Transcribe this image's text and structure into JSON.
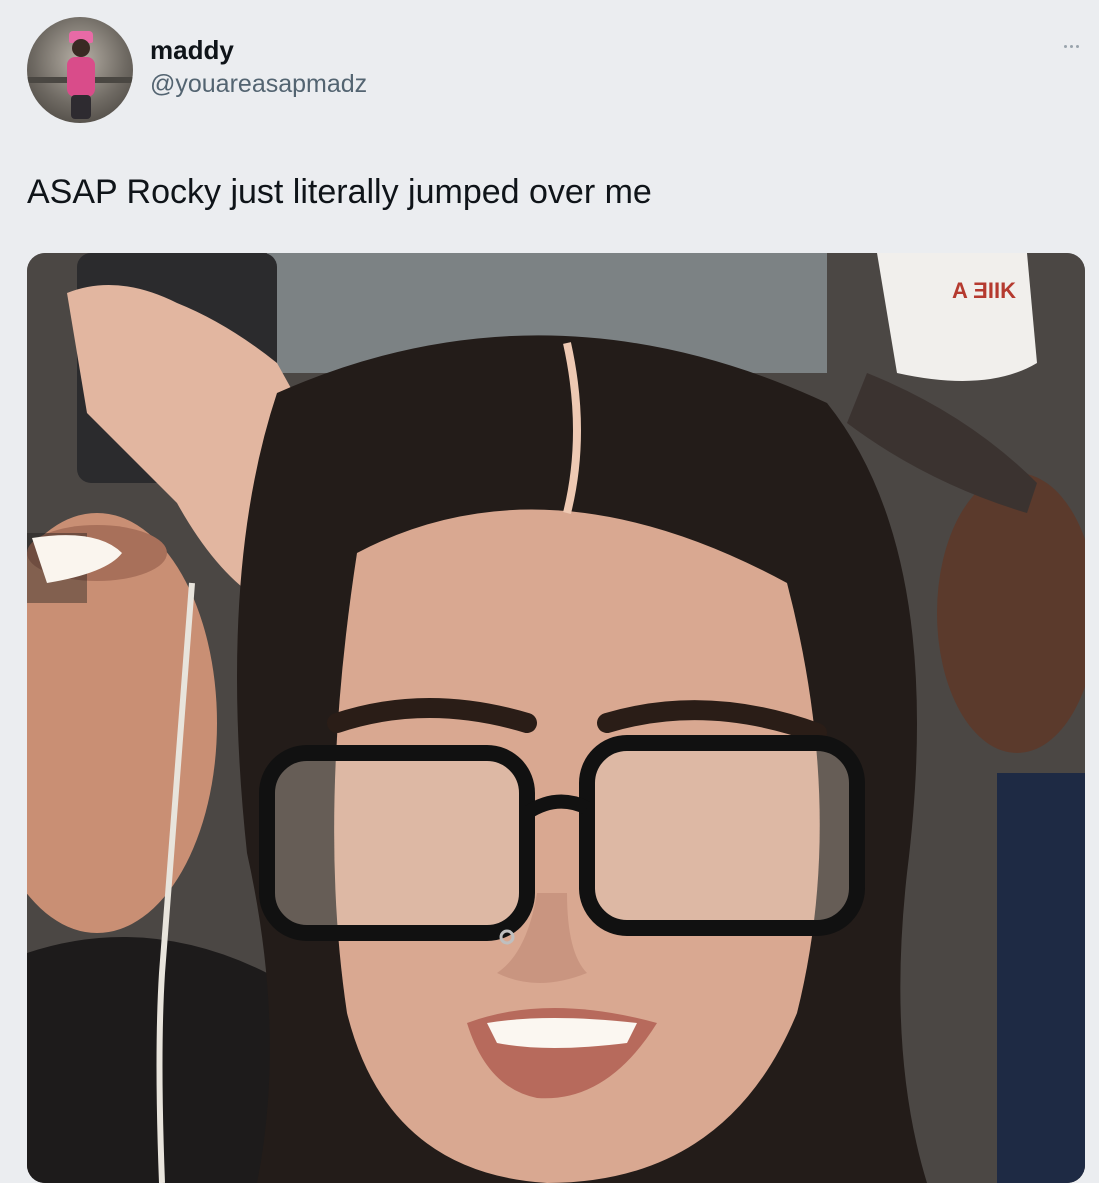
{
  "author": {
    "display_name": "maddy",
    "handle": "@youareasapmadz",
    "avatar_icon": "profile-photo"
  },
  "tweet": {
    "text": "ASAP Rocky just literally jumped over me"
  },
  "menu": {
    "icon": "more-icon"
  },
  "media": {
    "description_icon": "photo"
  },
  "colors": {
    "background": "#ebedf0",
    "primary_text": "#0f1419",
    "secondary_text": "#536471"
  }
}
